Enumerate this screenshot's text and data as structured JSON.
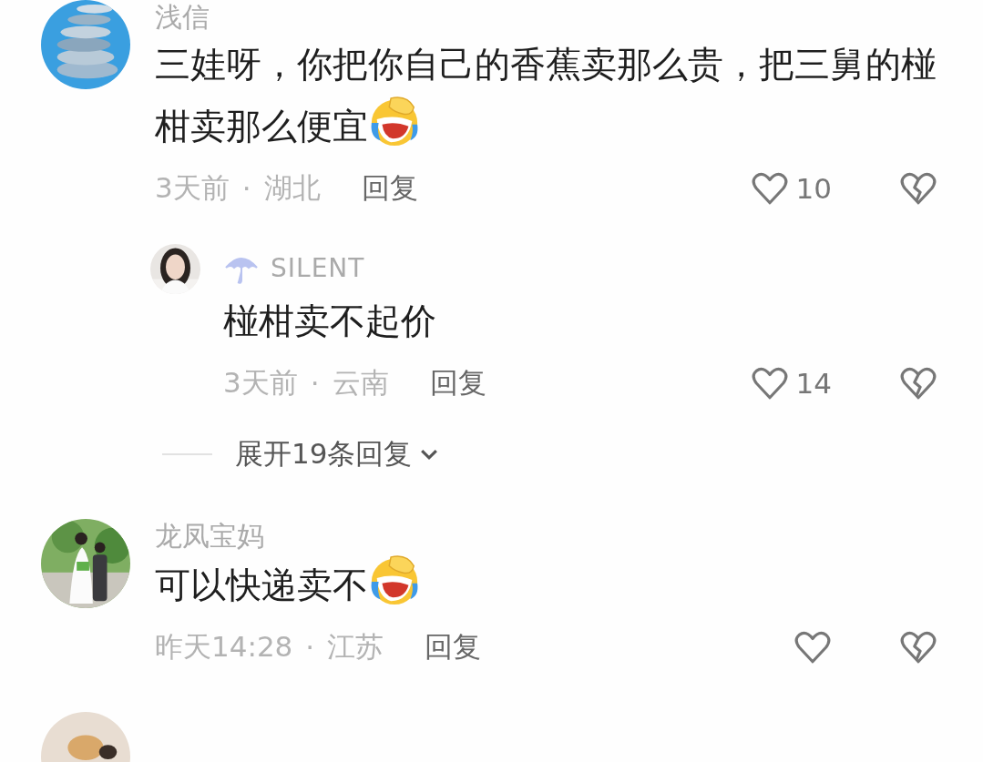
{
  "comments": [
    {
      "username": "浅信",
      "text": "三娃呀，你把你自己的香蕉卖那么贵，把三舅的椪柑卖那么便宜",
      "emoji": true,
      "time": "3天前",
      "separator": "·",
      "location": "湖北",
      "reply_label": "回复",
      "likes": "10",
      "replies": [
        {
          "username": "SILENT",
          "badge": true,
          "text": "椪柑卖不起价",
          "time": "3天前",
          "separator": "·",
          "location": "云南",
          "reply_label": "回复",
          "likes": "14"
        }
      ],
      "expand_label": "展开19条回复"
    },
    {
      "username": "龙凤宝妈",
      "text": "可以快递卖不",
      "emoji": true,
      "time": "昨天14:28",
      "separator": "·",
      "location": "江苏",
      "reply_label": "回复"
    }
  ]
}
